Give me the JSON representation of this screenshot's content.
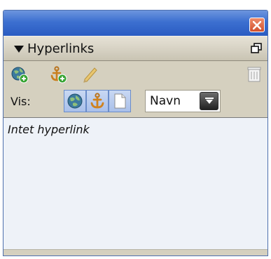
{
  "panel": {
    "tab_title": "Hyperlinks"
  },
  "toolbar": {
    "icons": [
      "globe-add-icon",
      "anchor-add-icon",
      "pencil-icon",
      "trash-icon"
    ]
  },
  "view": {
    "label": "Vis:",
    "filter_icons": [
      "globe-icon",
      "anchor-icon",
      "page-icon"
    ],
    "sort_value": "Navn"
  },
  "list": {
    "empty_text": "Intet hyperlink"
  },
  "colors": {
    "title_bar": "#3c6fd0",
    "close_button": "#d2512e",
    "panel_bg": "#d5d0bf",
    "list_bg": "#eef2f8"
  }
}
